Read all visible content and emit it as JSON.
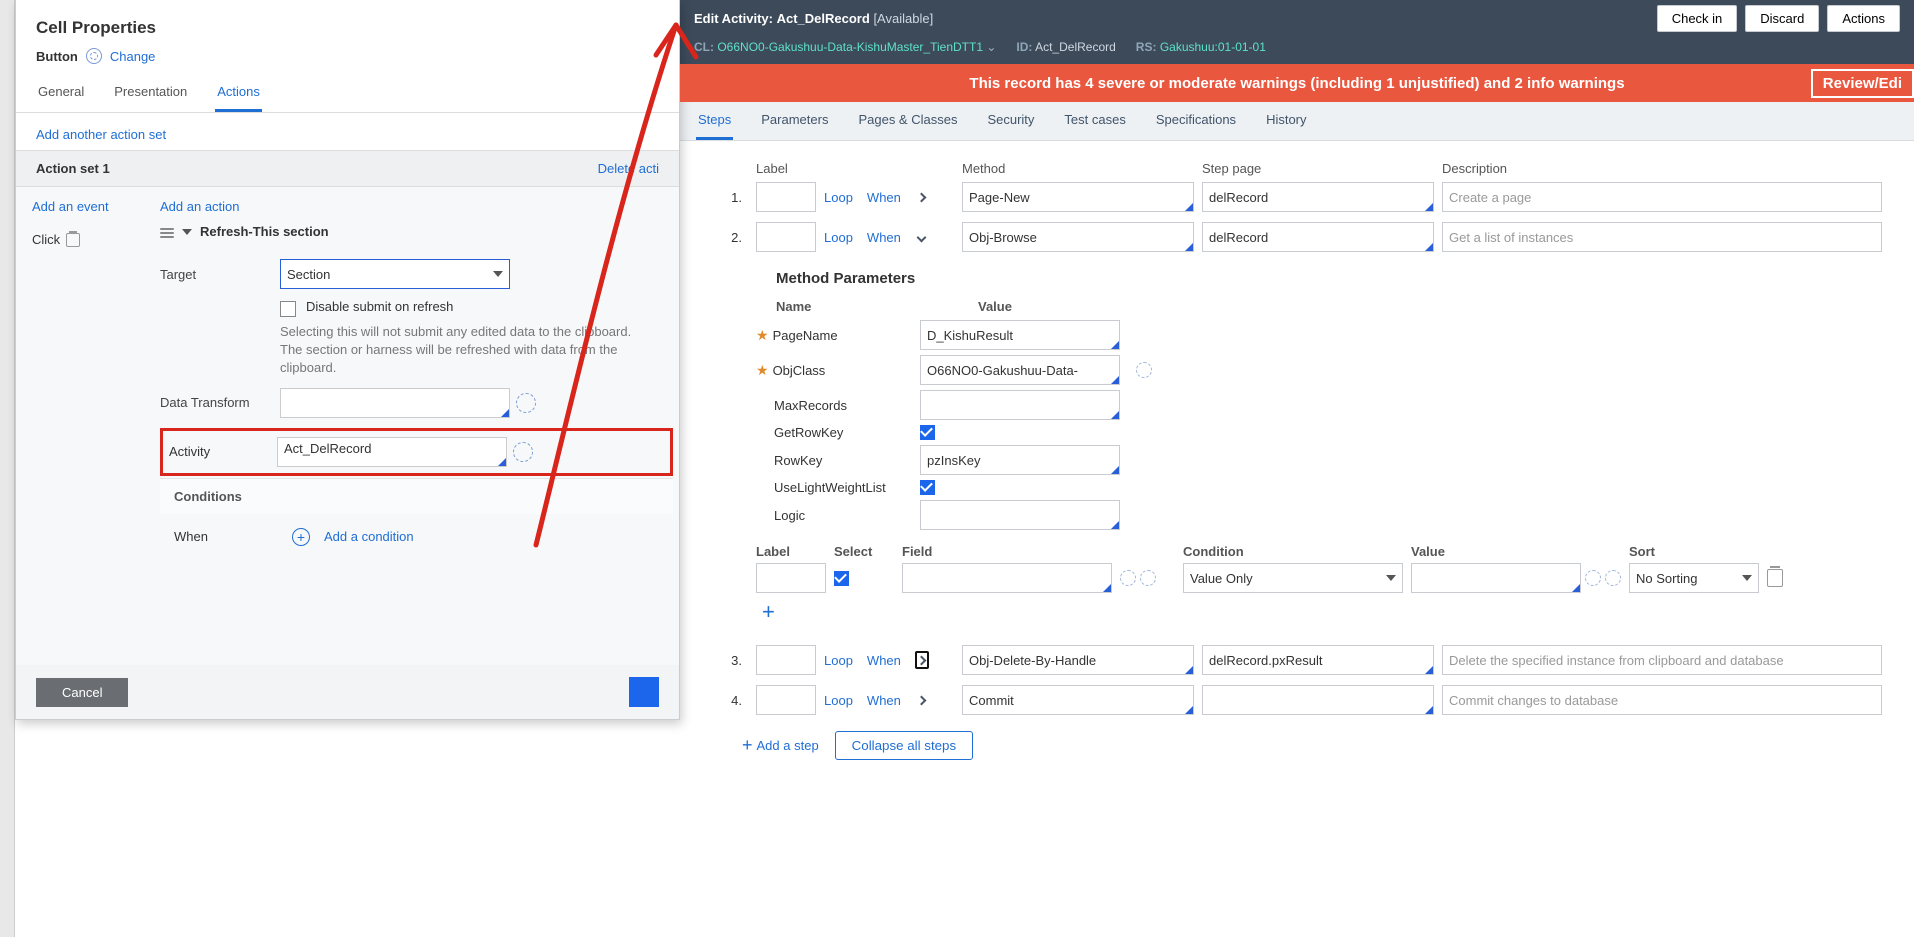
{
  "dialog": {
    "title": "Cell Properties",
    "type": "Button",
    "change": "Change",
    "tabs": [
      "General",
      "Presentation",
      "Actions"
    ],
    "active_tab": "Actions",
    "add_set": "Add another action set",
    "set_label": "Action set 1",
    "delete_set": "Delete acti",
    "events": {
      "add": "Add an event",
      "item": "Click"
    },
    "actions": {
      "add": "Add an action",
      "title": "Refresh-This section",
      "target_label": "Target",
      "target_value": "Section",
      "disable_label": "Disable submit on refresh",
      "disable_help": "Selecting this will not submit any edited data to the clipboard. The section or harness will be refreshed with data from the clipboard.",
      "dt_label": "Data Transform",
      "dt_value": "",
      "activity_label": "Activity",
      "activity_value": "Act_DelRecord",
      "conditions": "Conditions",
      "when": "When",
      "add_cond": "Add a condition"
    },
    "footer": {
      "cancel": "Cancel"
    }
  },
  "right": {
    "header": {
      "edit": "Edit Activity:",
      "name": "Act_DelRecord",
      "status": "[Available]",
      "checkin": "Check in",
      "discard": "Discard",
      "actions": "Actions",
      "cl_k": "CL:",
      "cl_v": "O66NO0-Gakushuu-Data-KishuMaster_TienDTT1",
      "id_k": "ID:",
      "id_v": "Act_DelRecord",
      "rs_k": "RS:",
      "rs_v": "Gakushuu:01-01-01"
    },
    "alert": {
      "text": "This record has 4 severe or moderate warnings (including 1 unjustified) and 2 info warnings",
      "review": "Review/Edi"
    },
    "tabs": [
      "Steps",
      "Parameters",
      "Pages & Classes",
      "Security",
      "Test cases",
      "Specifications",
      "History"
    ],
    "active_tab": "Steps",
    "steps_header": {
      "label": "Label",
      "method": "Method",
      "page": "Step page",
      "desc": "Description"
    },
    "steps": [
      {
        "n": "1.",
        "label": "",
        "method": "Page-New",
        "page": "delRecord",
        "desc": "Create a page",
        "arrow": "right"
      },
      {
        "n": "2.",
        "label": "",
        "method": "Obj-Browse",
        "page": "delRecord",
        "desc": "Get a list of instances",
        "arrow": "down"
      },
      {
        "n": "3.",
        "label": "",
        "method": "Obj-Delete-By-Handle",
        "page": "delRecord.pxResult",
        "desc": "Delete the specified instance from clipboard and database",
        "arrow": "boxright"
      },
      {
        "n": "4.",
        "label": "",
        "method": "Commit",
        "page": "",
        "desc": "Commit changes to database",
        "arrow": "right"
      }
    ],
    "mparams_title": "Method Parameters",
    "mparams_hdr": {
      "name": "Name",
      "value": "Value"
    },
    "mparams": [
      {
        "name": "PageName",
        "star": true,
        "type": "text",
        "value": "D_KishuResult"
      },
      {
        "name": "ObjClass",
        "star": true,
        "type": "text",
        "value": "O66NO0-Gakushuu-Data-",
        "gear": true
      },
      {
        "name": "MaxRecords",
        "type": "text",
        "value": ""
      },
      {
        "name": "GetRowKey",
        "type": "check",
        "checked": true
      },
      {
        "name": "RowKey",
        "type": "text",
        "value": "pzInsKey"
      },
      {
        "name": "UseLightWeightList",
        "type": "check",
        "checked": true
      },
      {
        "name": "Logic",
        "type": "text",
        "value": ""
      }
    ],
    "logic_hdr": {
      "label": "Label",
      "select": "Select",
      "field": "Field",
      "cond": "Condition",
      "value": "Value",
      "sort": "Sort"
    },
    "logic_row": {
      "label": "",
      "select": true,
      "field": "",
      "cond": "Value Only",
      "value": "",
      "sort": "No Sorting"
    },
    "loop": "Loop",
    "when": "When",
    "add_step": "Add a step",
    "collapse": "Collapse all steps"
  }
}
